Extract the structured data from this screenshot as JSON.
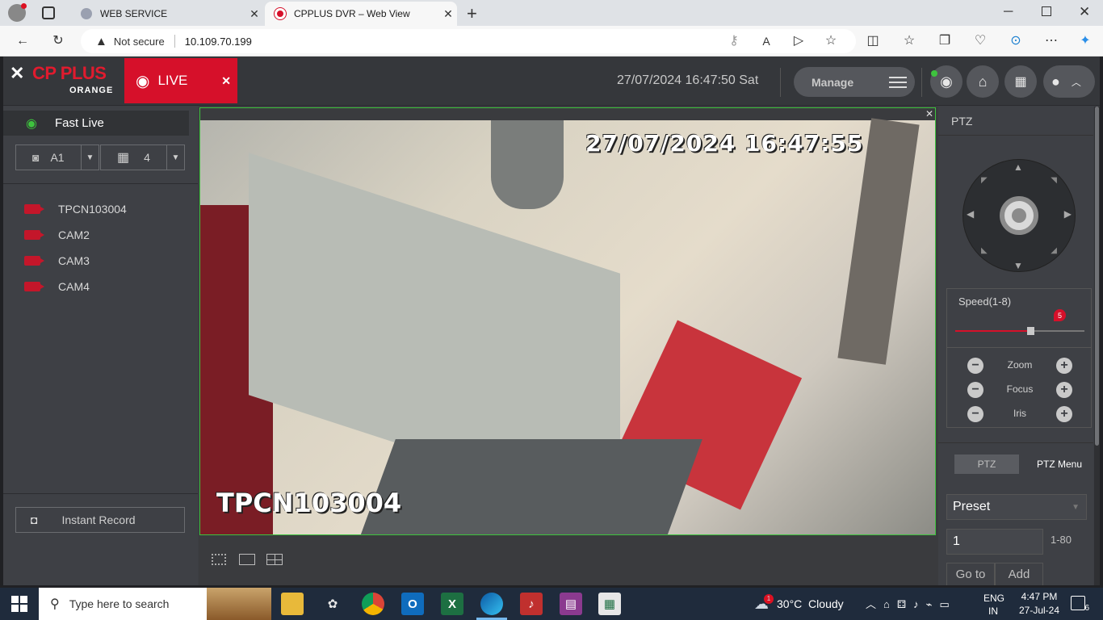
{
  "browser": {
    "tabs": [
      {
        "title": "WEB SERVICE"
      },
      {
        "title": "CPPLUS DVR – Web View"
      }
    ],
    "security_label": "Not secure",
    "url": "10.109.70.199"
  },
  "app": {
    "brand": {
      "line1": "CP PLUS",
      "line2": "ORANGE"
    },
    "live_label": "LIVE",
    "datetime": "27/07/2024 16:47:50 Sat",
    "manage_label": "Manage"
  },
  "sidebar": {
    "fast_live": "Fast Live",
    "stream_select": "A1",
    "layout_select": "4",
    "cameras": [
      {
        "name": "TPCN103004"
      },
      {
        "name": "CAM2"
      },
      {
        "name": "CAM3"
      },
      {
        "name": "CAM4"
      }
    ],
    "instant_record": "Instant Record"
  },
  "video": {
    "osd_timestamp": "27/07/2024 16:47:55",
    "osd_channel": "TPCN103004"
  },
  "ptz": {
    "title": "PTZ",
    "speed_label": "Speed(1-8)",
    "speed_value": "5",
    "speed_level_fraction": 0.58,
    "zoom_label": "Zoom",
    "focus_label": "Focus",
    "iris_label": "Iris",
    "tab_ptz": "PTZ",
    "tab_ptz_menu": "PTZ Menu",
    "preset_select": "Preset",
    "preset_number": "1",
    "preset_range": "1-80",
    "goto_label": "Go to",
    "add_label": "Add"
  },
  "taskbar": {
    "search_placeholder": "Type here to search",
    "weather": "30°C  Cloudy",
    "weather_badge": "1",
    "lang_top": "ENG",
    "lang_bottom": "IN",
    "time": "4:47 PM",
    "date": "27-Jul-24",
    "notif_count": "6"
  },
  "colors": {
    "accent": "#d6102a",
    "video_border": "#3ec33e",
    "fast_live_icon": "#3ec33e"
  }
}
